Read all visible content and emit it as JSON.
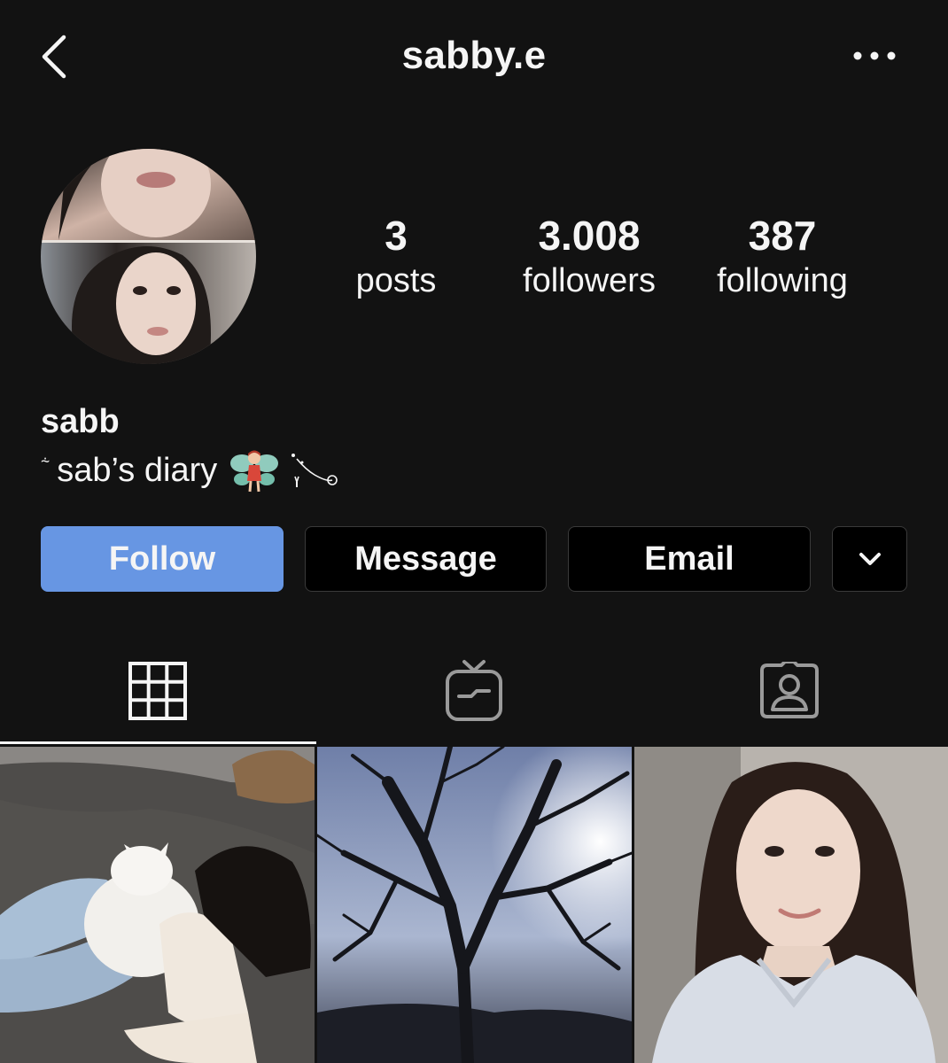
{
  "header": {
    "username": "sabby.e",
    "back_icon": "chevron-left-icon",
    "more_icon": "ellipsis-icon"
  },
  "stats": {
    "posts": {
      "value": "3",
      "label": "posts"
    },
    "followers": {
      "value": "3.008",
      "label": "followers"
    },
    "following": {
      "value": "387",
      "label": "following"
    }
  },
  "profile": {
    "display_name": "sabb",
    "bio_prefix": "⸞",
    "bio_text": "sab’s diary",
    "bio_emoji": "fairy-emoji",
    "bio_deco": "sparkle-trail"
  },
  "actions": {
    "follow": "Follow",
    "message": "Message",
    "email": "Email",
    "dropdown_icon": "chevron-down-icon"
  },
  "tabs": [
    {
      "name": "posts-grid",
      "icon": "grid-icon",
      "active": true
    },
    {
      "name": "igtv",
      "icon": "igtv-icon",
      "active": false
    },
    {
      "name": "tagged",
      "icon": "tagged-person-icon",
      "active": false
    }
  ],
  "colors": {
    "background": "#121212",
    "follow_button": "#6796e3",
    "text": "#f5f5f5",
    "button_border": "#3a3a3a"
  }
}
